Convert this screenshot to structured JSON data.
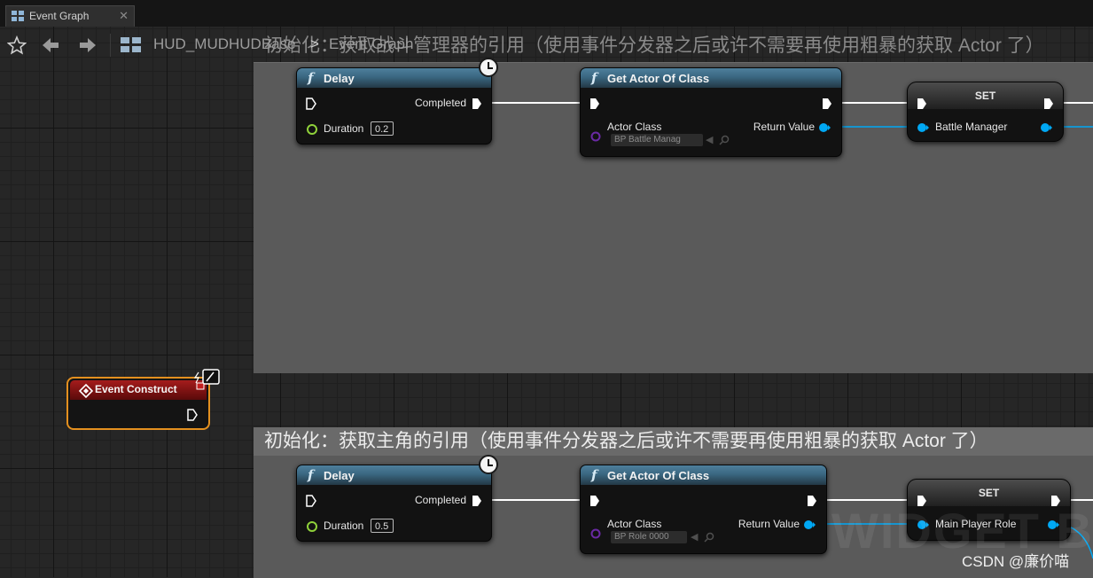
{
  "window": {
    "tab_label": "Event Graph",
    "tab_close": "✕"
  },
  "toolbar": {
    "breadcrumb": [
      {
        "label": "HUD_MUDHUDBase"
      },
      {
        "label": "Event Graph"
      }
    ],
    "separator": ">"
  },
  "comments": [
    {
      "title": "初始化：获取战斗管理器的引用（使用事件分发器之后或许不需要再使用粗暴的获取 Actor 了）",
      "faded": true
    },
    {
      "title": "初始化：获取主角的引用（使用事件分发器之后或许不需要再使用粗暴的获取 Actor 了）",
      "faded": false
    }
  ],
  "event_node": {
    "title": "Event Construct"
  },
  "rows": [
    {
      "delay": {
        "title": "Delay",
        "completed": "Completed",
        "duration_label": "Duration",
        "duration_value": "0.2"
      },
      "get_actor": {
        "title": "Get Actor Of Class",
        "actor_class_label": "Actor Class",
        "actor_class_value": "BP Battle Manag",
        "return_label": "Return Value"
      },
      "set": {
        "title": "SET",
        "variable": "Battle Manager"
      }
    },
    {
      "delay": {
        "title": "Delay",
        "completed": "Completed",
        "duration_label": "Duration",
        "duration_value": "0.5"
      },
      "get_actor": {
        "title": "Get Actor Of Class",
        "actor_class_label": "Actor Class",
        "actor_class_value": "BP Role 0000",
        "return_label": "Return Value"
      },
      "set": {
        "title": "SET",
        "variable": "Main Player Role"
      }
    }
  ],
  "watermark": "WIDGET BLU",
  "credit": "CSDN @廉价喵",
  "colors": {
    "exec_wire": "#ffffff",
    "object_wire": "#00a8f4",
    "float_pin": "#8fd13a",
    "class_pin": "#5d1f8f",
    "event_border": "#e4901f",
    "function_header": "#3a6781",
    "event_header": "#a51c1c"
  },
  "icons": [
    "blueprint-icon",
    "star-icon",
    "arrow-left-icon",
    "arrow-right-icon",
    "function-icon",
    "latent-clock-icon",
    "event-icon",
    "exec-pin-icon",
    "data-pin-icon",
    "arrow-icon",
    "search-icon"
  ]
}
